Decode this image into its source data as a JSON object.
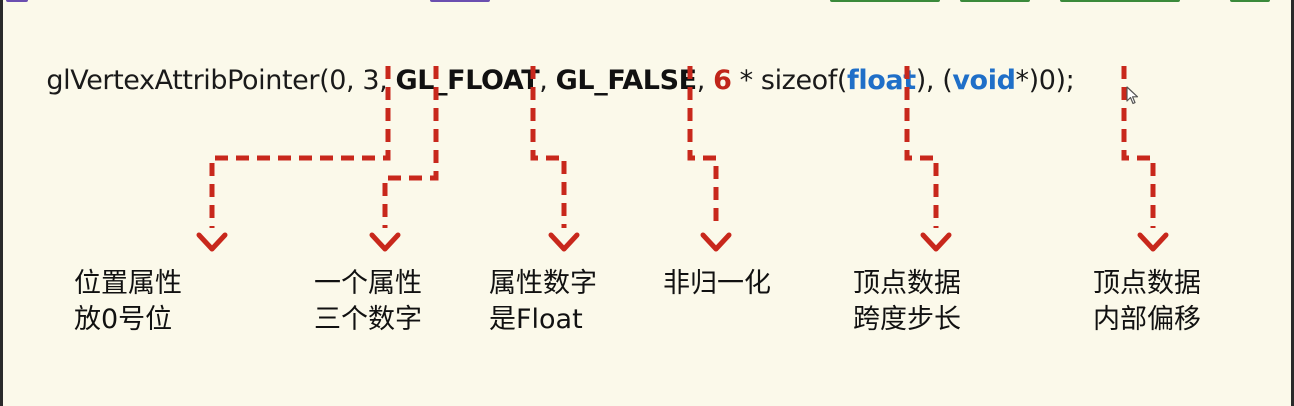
{
  "code": {
    "tokens": [
      {
        "text": "glVertexAttribPointer(0, 3, ",
        "style": "plain"
      },
      {
        "text": "GL_FLOAT",
        "style": "kw"
      },
      {
        "text": ", ",
        "style": "plain"
      },
      {
        "text": "GL_FALSE",
        "style": "kw"
      },
      {
        "text": ", ",
        "style": "plain"
      },
      {
        "text": "6",
        "style": "num"
      },
      {
        "text": " * sizeof(",
        "style": "plain"
      },
      {
        "text": "float",
        "style": "type"
      },
      {
        "text": "), (",
        "style": "plain"
      },
      {
        "text": "void",
        "style": "type"
      },
      {
        "text": "*)0);",
        "style": "plain"
      }
    ]
  },
  "annotations": [
    {
      "line1": "位置属性",
      "line2": "放0号位"
    },
    {
      "line1": "一个属性",
      "line2": "三个数字"
    },
    {
      "line1": "属性数字",
      "line2": "是Float"
    },
    {
      "line1": "非归一化",
      "line2": ""
    },
    {
      "line1": "顶点数据",
      "line2": "跨度步长"
    },
    {
      "line1": "顶点数据",
      "line2": "内部偏移"
    }
  ],
  "colors": {
    "background": "#fbf9ea",
    "arrow": "#c8281c",
    "keyword": "#111111",
    "number": "#c0251a",
    "type": "#1f6fc8"
  }
}
